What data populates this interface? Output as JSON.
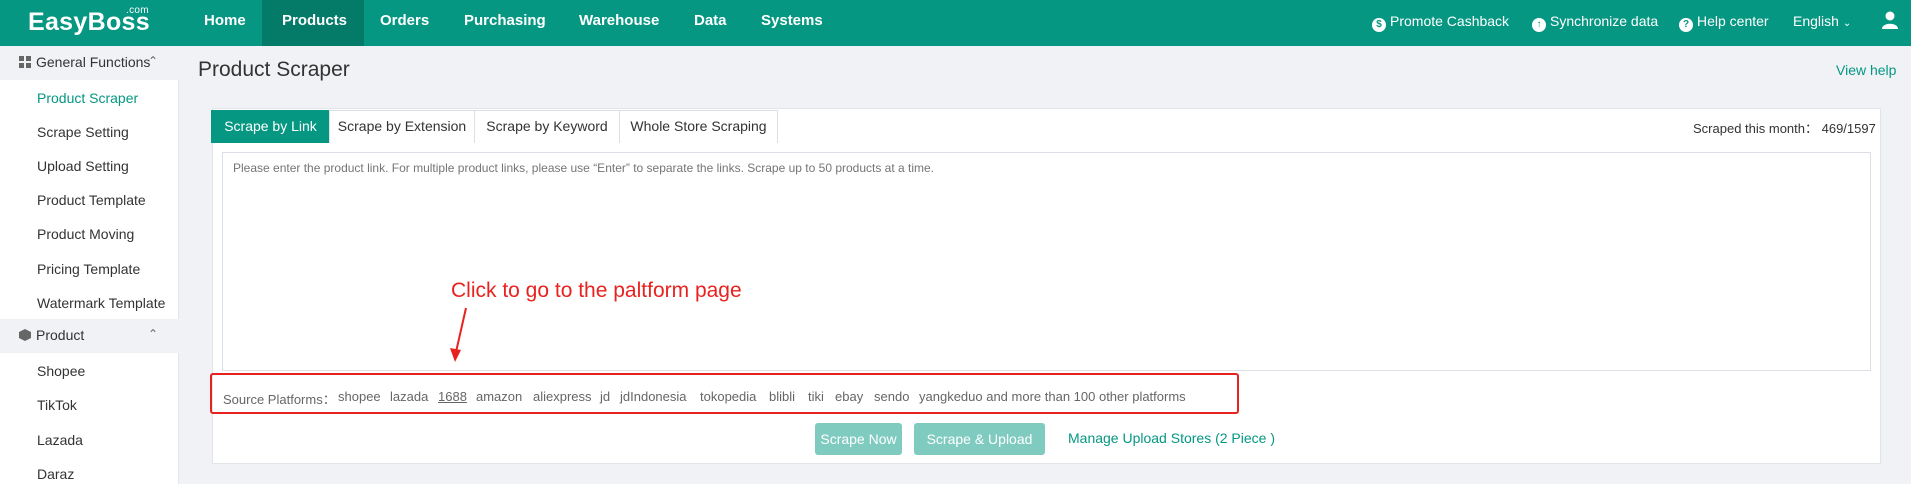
{
  "brand": {
    "name": "EasyBoss",
    "suffix": ".com"
  },
  "nav": {
    "items": [
      {
        "label": "Home"
      },
      {
        "label": "Products"
      },
      {
        "label": "Orders"
      },
      {
        "label": "Purchasing"
      },
      {
        "label": "Warehouse"
      },
      {
        "label": "Data"
      },
      {
        "label": "Systems"
      }
    ],
    "right": {
      "promote": "Promote Cashback",
      "sync": "Synchronize data",
      "help": "Help center",
      "language": "English"
    }
  },
  "sidebar": {
    "groups": [
      {
        "label": "General Functions",
        "items": [
          "Product Scraper",
          "Scrape Setting",
          "Upload Setting",
          "Product Template",
          "Product Moving",
          "Pricing Template",
          "Watermark Template"
        ]
      },
      {
        "label": "Product",
        "items": [
          "Shopee",
          "TikTok",
          "Lazada",
          "Daraz"
        ]
      }
    ]
  },
  "main": {
    "title": "Product Scraper",
    "view_help": "View help",
    "tabs": [
      {
        "label": "Scrape by Link"
      },
      {
        "label": "Scrape by Extension"
      },
      {
        "label": "Scrape by Keyword"
      },
      {
        "label": "Whole Store Scraping"
      }
    ],
    "scraped_count": "Scraped this month： 469/1597",
    "input_placeholder": "Please enter the product link. For multiple product links, please use “Enter” to separate the links. Scrape up to 50 products at a time.",
    "annotation": "Click to go to the paltform page",
    "source_label": "Source Platforms：",
    "platforms": [
      "shopee",
      "lazada",
      "1688",
      "amazon",
      "aliexpress",
      "jd",
      "jdIndonesia",
      "tokopedia",
      "blibli",
      "tiki",
      "ebay",
      "sendo",
      "yangkeduo and more than 100 other platforms"
    ],
    "buttons": {
      "scrape_now": "Scrape Now",
      "scrape_upload": "Scrape & Upload"
    },
    "manage_stores": "Manage Upload Stores (2 Piece )"
  },
  "colors": {
    "primary": "#059782",
    "annotation_red": "#e8231f",
    "button_disabled": "#7fcbc0"
  }
}
